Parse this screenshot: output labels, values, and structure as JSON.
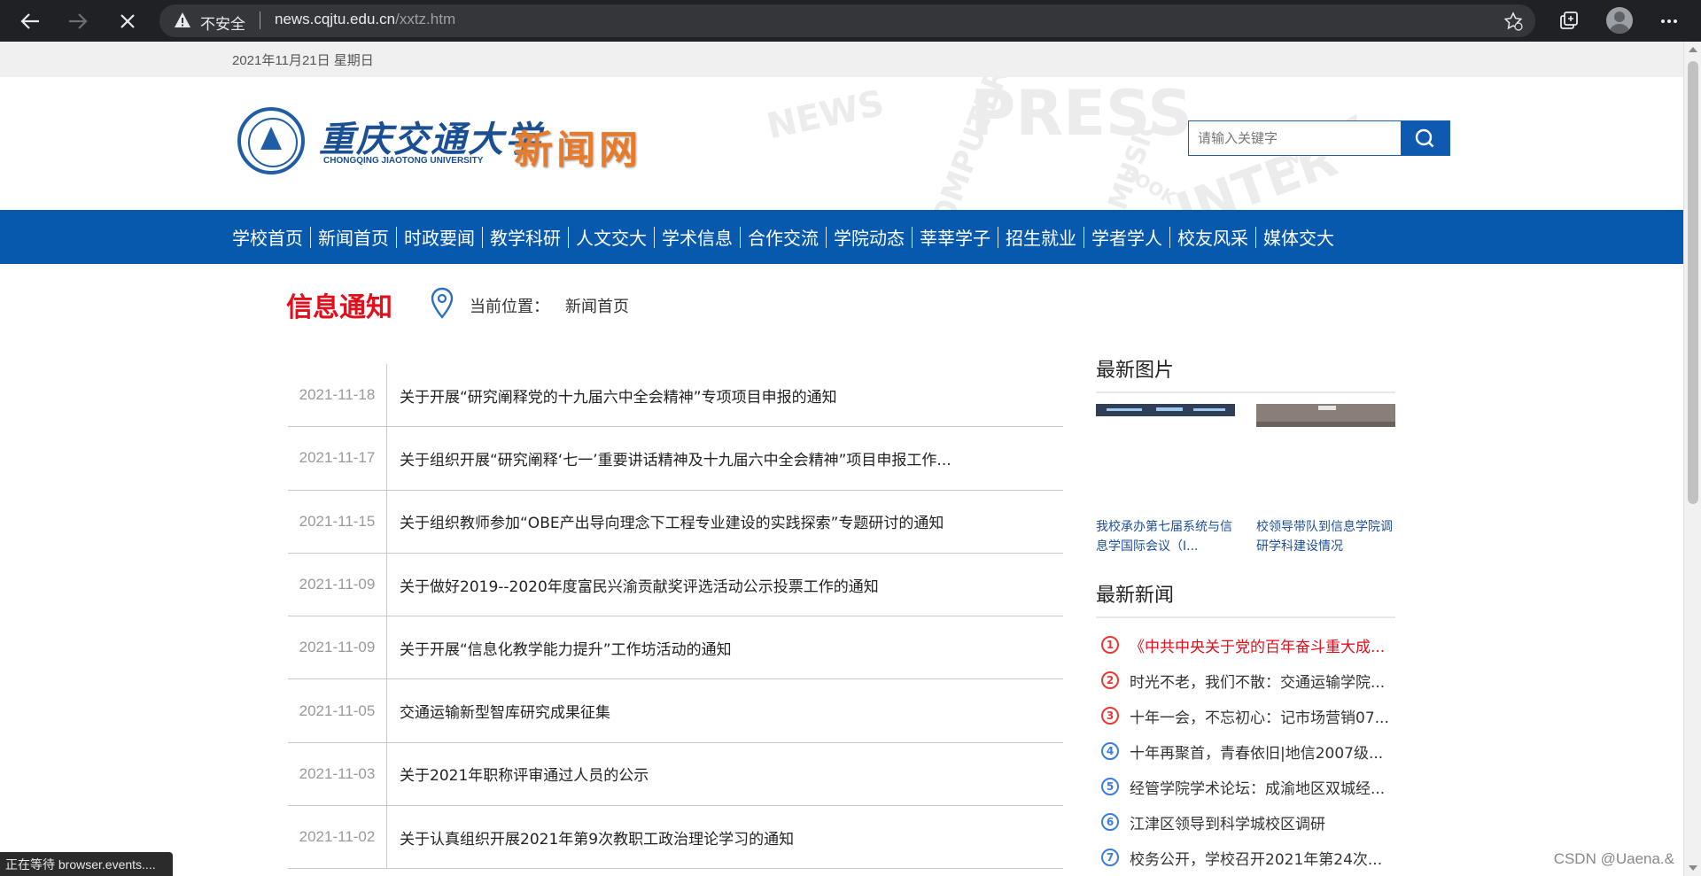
{
  "browser": {
    "security_label": "不安全",
    "url_host": "news.cqjtu.edu.cn",
    "url_path": "/xxtz.htm",
    "status_text": "正在等待 browser.events...."
  },
  "topbar": {
    "date": "2021年11月21日 星期日"
  },
  "header": {
    "logo_cn": "重庆交通大学",
    "logo_en": "CHONGQING JIAOTONG UNIVERSITY",
    "logo_news": "新闻网",
    "search_placeholder": "请输入关键字"
  },
  "nav": {
    "items": [
      "学校首页",
      "新闻首页",
      "时政要闻",
      "教学科研",
      "人文交大",
      "学术信息",
      "合作交流",
      "学院动态",
      "莘莘学子",
      "招生就业",
      "学者学人",
      "校友风采",
      "媒体交大"
    ]
  },
  "section": {
    "title": "信息通知",
    "location_label": "当前位置：",
    "location_value": "新闻首页"
  },
  "news": [
    {
      "date": "2021-11-18",
      "title": "关于开展“研究阐释党的十九届六中全会精神”专项项目申报的通知"
    },
    {
      "date": "2021-11-17",
      "title": "关于组织开展“研究阐释‘七一’重要讲话精神及十九届六中全会精神”项目申报工作..."
    },
    {
      "date": "2021-11-15",
      "title": "关于组织教师参加“OBE产出导向理念下工程专业建设的实践探索”专题研讨的通知"
    },
    {
      "date": "2021-11-09",
      "title": "关于做好2019--2020年度富民兴渝贡献奖评选活动公示投票工作的通知"
    },
    {
      "date": "2021-11-09",
      "title": "关于开展“信息化教学能力提升”工作坊活动的通知"
    },
    {
      "date": "2021-11-05",
      "title": "交通运输新型智库研究成果征集"
    },
    {
      "date": "2021-11-03",
      "title": "关于2021年职称评审通过人员的公示"
    },
    {
      "date": "2021-11-02",
      "title": "关于认真组织开展2021年第9次教职工政治理论学习的通知"
    }
  ],
  "sidebar": {
    "pictures_heading": "最新图片",
    "pictures": [
      {
        "caption": "我校承办第七届系统与信息学国际会议（I..."
      },
      {
        "caption": "校领导带队到信息学院调研学科建设情况"
      }
    ],
    "latest_heading": "最新新闻",
    "latest": [
      {
        "num": "1",
        "text": "《中共中央关于党的百年奋斗重大成..."
      },
      {
        "num": "2",
        "text": "时光不老，我们不散：交通运输学院..."
      },
      {
        "num": "3",
        "text": "十年一会，不忘初心：记市场营销07..."
      },
      {
        "num": "4",
        "text": "十年再聚首，青春依旧|地信2007级..."
      },
      {
        "num": "5",
        "text": "经管学院学术论坛：成渝地区双城经..."
      },
      {
        "num": "6",
        "text": "江津区领导到科学城校区调研"
      },
      {
        "num": "7",
        "text": "校务公开，学校召开2021年第24次..."
      }
    ]
  },
  "watermark": "CSDN @Uaena.&"
}
